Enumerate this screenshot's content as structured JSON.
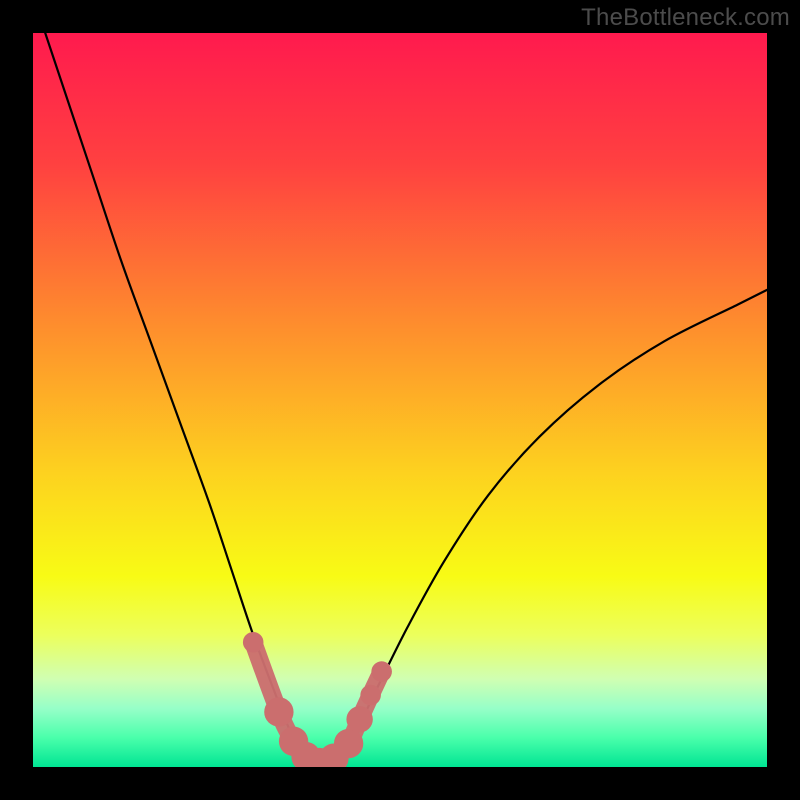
{
  "watermark": "TheBottleneck.com",
  "chart_data": {
    "type": "line",
    "title": "",
    "xlabel": "",
    "ylabel": "",
    "xlim": [
      0,
      100
    ],
    "ylim": [
      0,
      100
    ],
    "grid": false,
    "legend": false,
    "background_gradient_stops": [
      {
        "offset": 0,
        "color": "#ff1a4e"
      },
      {
        "offset": 18,
        "color": "#ff4140"
      },
      {
        "offset": 40,
        "color": "#fe8e2d"
      },
      {
        "offset": 60,
        "color": "#fdd21f"
      },
      {
        "offset": 74,
        "color": "#f8fb15"
      },
      {
        "offset": 82,
        "color": "#ecff5c"
      },
      {
        "offset": 88,
        "color": "#d0ffb2"
      },
      {
        "offset": 92,
        "color": "#97ffc8"
      },
      {
        "offset": 96,
        "color": "#4affab"
      },
      {
        "offset": 100,
        "color": "#00e593"
      }
    ],
    "series": [
      {
        "name": "bottleneck-curve",
        "x": [
          0,
          4,
          8,
          12,
          16,
          20,
          24,
          27,
          30,
          33,
          35,
          37,
          39,
          41,
          44,
          47,
          51,
          56,
          62,
          69,
          77,
          86,
          96,
          100
        ],
        "y": [
          105,
          93,
          81,
          69,
          58,
          47,
          36,
          27,
          18,
          10,
          5,
          1.5,
          0.2,
          1.5,
          5,
          11,
          19,
          28,
          37,
          45,
          52,
          58,
          63,
          65
        ]
      }
    ],
    "markers": {
      "name": "highlight-points",
      "color": "#cb6e6e",
      "points": [
        {
          "x": 30.0,
          "y": 17.0,
          "r": 1.4
        },
        {
          "x": 33.5,
          "y": 7.5,
          "r": 2.0
        },
        {
          "x": 35.5,
          "y": 3.5,
          "r": 2.0
        },
        {
          "x": 37.2,
          "y": 1.4,
          "r": 2.0
        },
        {
          "x": 39.0,
          "y": 0.6,
          "r": 2.0
        },
        {
          "x": 41.0,
          "y": 1.2,
          "r": 2.0
        },
        {
          "x": 43.0,
          "y": 3.2,
          "r": 2.0
        },
        {
          "x": 44.5,
          "y": 6.5,
          "r": 1.8
        },
        {
          "x": 46.0,
          "y": 9.8,
          "r": 1.4
        },
        {
          "x": 47.5,
          "y": 13.0,
          "r": 1.4
        }
      ]
    }
  }
}
